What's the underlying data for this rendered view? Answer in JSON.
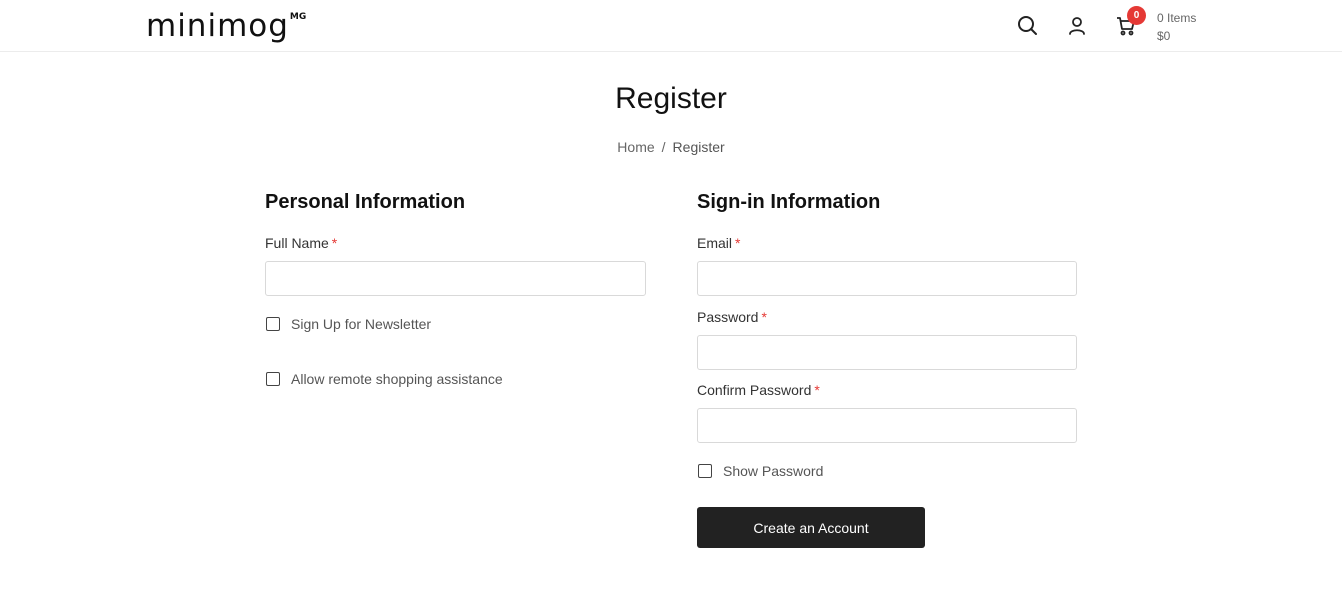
{
  "header": {
    "logo": "minimog",
    "logo_sup": "MG",
    "icons": [
      "search-icon",
      "user-icon",
      "cart-icon"
    ],
    "cart_count": "0",
    "cart_items": "0 Items",
    "cart_total": "$0"
  },
  "page": {
    "title": "Register",
    "breadcrumb": {
      "home": "Home",
      "separator": "/",
      "current": "Register"
    }
  },
  "personal": {
    "title": "Personal Information",
    "full_name_label": "Full Name",
    "required_mark": "*",
    "full_name_value": "",
    "newsletter_label": "Sign Up for Newsletter",
    "newsletter_checked": false,
    "assistance_label": "Allow remote shopping assistance",
    "assistance_checked": false
  },
  "signin": {
    "title": "Sign-in Information",
    "email_label": "Email",
    "password_label": "Password",
    "confirm_label": "Confirm Password",
    "required_mark": "*",
    "show_password_label": "Show Password",
    "show_password_checked": false,
    "submit_label": "Create an Account"
  },
  "colors": {
    "accent": "#e53935",
    "button": "#222222",
    "border": "#d9d9d9"
  }
}
